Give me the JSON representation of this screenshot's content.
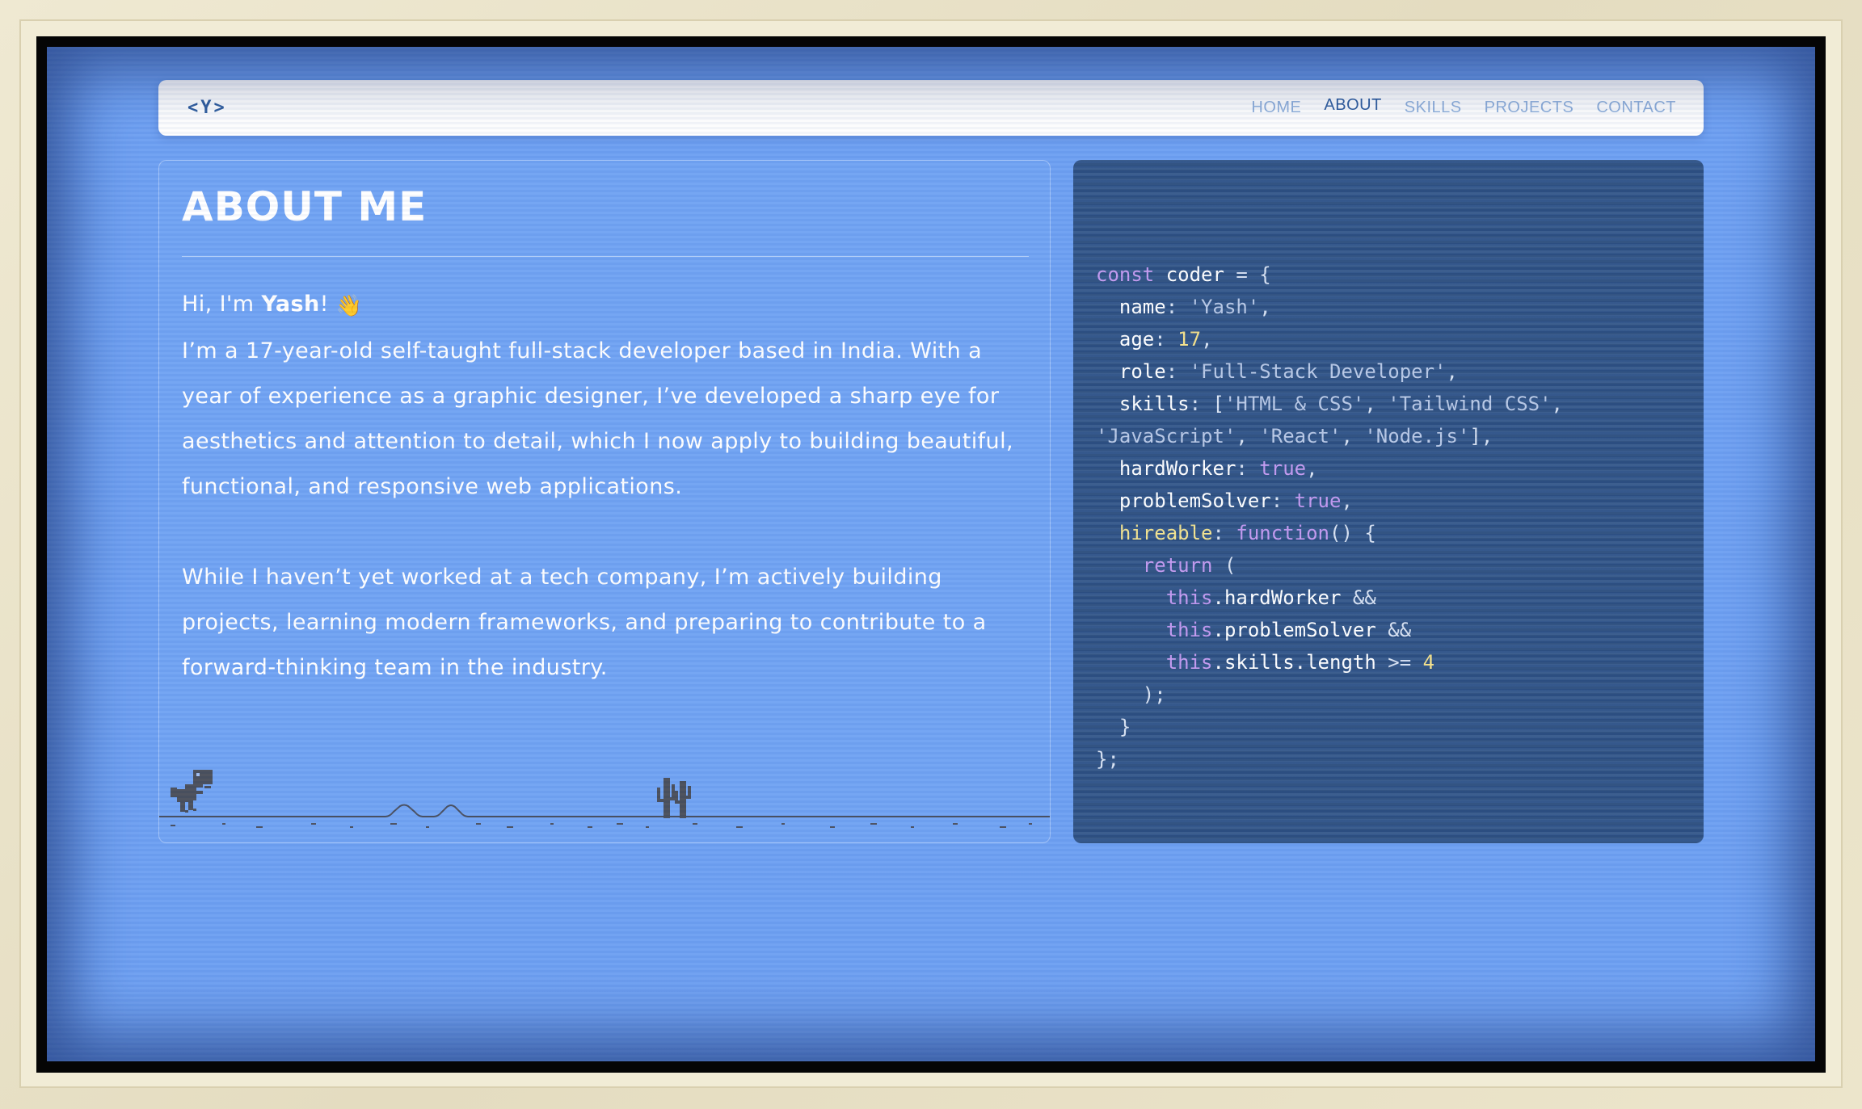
{
  "navbar": {
    "logo": "<Y>",
    "links": [
      {
        "label": "HOME",
        "active": false
      },
      {
        "label": "ABOUT",
        "active": true
      },
      {
        "label": "SKILLS",
        "active": false
      },
      {
        "label": "PROJECTS",
        "active": false
      },
      {
        "label": "CONTACT",
        "active": false
      }
    ]
  },
  "about": {
    "title": "ABOUT ME",
    "greeting_prefix": "Hi, I'm ",
    "name": "Yash",
    "greeting_suffix": "!",
    "wave_emoji": "👋",
    "paragraph1": "I’m a 17-year-old self-taught full-stack developer based in India. With a year of experience as a graphic designer, I’ve developed a sharp eye for aesthetics and attention to detail, which I now apply to building beautiful, functional, and responsive web applications.",
    "paragraph2": "While I haven’t yet worked at a tech company, I’m actively building projects, learning modern frameworks, and preparing to contribute to a forward-thinking team in the industry."
  },
  "code": {
    "lines": [
      [
        [
          "kw",
          "const"
        ],
        [
          "prop",
          " coder "
        ],
        [
          "punc",
          "= {"
        ]
      ],
      [
        [
          "prop",
          "  name"
        ],
        [
          "punc",
          ": "
        ],
        [
          "str",
          "'Yash'"
        ],
        [
          "punc",
          ","
        ]
      ],
      [
        [
          "prop",
          "  age"
        ],
        [
          "punc",
          ": "
        ],
        [
          "num",
          "17"
        ],
        [
          "punc",
          ","
        ]
      ],
      [
        [
          "prop",
          "  role"
        ],
        [
          "punc",
          ": "
        ],
        [
          "str",
          "'Full-Stack Developer'"
        ],
        [
          "punc",
          ","
        ]
      ],
      [
        [
          "prop",
          "  skills"
        ],
        [
          "punc",
          ": ["
        ],
        [
          "str",
          "'HTML & CSS'"
        ],
        [
          "punc",
          ", "
        ],
        [
          "str",
          "'Tailwind CSS'"
        ],
        [
          "punc",
          ","
        ]
      ],
      [
        [
          "str",
          "'JavaScript'"
        ],
        [
          "punc",
          ", "
        ],
        [
          "str",
          "'React'"
        ],
        [
          "punc",
          ", "
        ],
        [
          "str",
          "'Node.js'"
        ],
        [
          "punc",
          "],"
        ]
      ],
      [
        [
          "prop",
          "  hardWorker"
        ],
        [
          "punc",
          ": "
        ],
        [
          "kw",
          "true"
        ],
        [
          "punc",
          ","
        ]
      ],
      [
        [
          "prop",
          "  problemSolver"
        ],
        [
          "punc",
          ": "
        ],
        [
          "kw",
          "true"
        ],
        [
          "punc",
          ","
        ]
      ],
      [
        [
          "fn",
          "  hireable"
        ],
        [
          "punc",
          ": "
        ],
        [
          "kw",
          "function"
        ],
        [
          "punc",
          "() {"
        ]
      ],
      [
        [
          "kw",
          "    return"
        ],
        [
          "punc",
          " ("
        ]
      ],
      [
        [
          "kw",
          "      this"
        ],
        [
          "prop",
          ".hardWorker "
        ],
        [
          "punc",
          "&&"
        ]
      ],
      [
        [
          "kw",
          "      this"
        ],
        [
          "prop",
          ".problemSolver "
        ],
        [
          "punc",
          "&&"
        ]
      ],
      [
        [
          "kw",
          "      this"
        ],
        [
          "prop",
          ".skills.length "
        ],
        [
          "punc",
          ">= "
        ],
        [
          "num",
          "4"
        ]
      ],
      [
        [
          "punc",
          "    );"
        ]
      ],
      [
        [
          "punc",
          "  }"
        ]
      ],
      [
        [
          "punc",
          "};"
        ]
      ]
    ]
  },
  "colors": {
    "screen_bg": "#6ea0f2",
    "code_bg": "#2f5387",
    "nav_active": "#2f5d9e",
    "nav_inactive": "#8fb0dc",
    "keyword": "#c49af0",
    "string": "#b9c9e6",
    "number": "#f6e28a"
  },
  "icons": {
    "dino": "dino-icon",
    "cactus": "cactus-icon",
    "wave": "wave-icon"
  }
}
